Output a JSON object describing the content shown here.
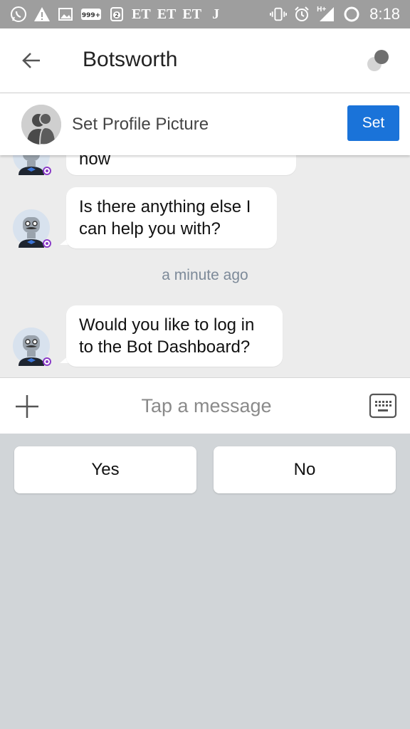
{
  "status_bar": {
    "time": "8:18",
    "notif_badge": "999+",
    "notif_badge2": "2",
    "carrier_marks": [
      "ET",
      "ET",
      "ET"
    ],
    "j_mark": "J",
    "network_label": "H+",
    "icons": [
      "whatsapp-icon",
      "warning-icon",
      "image-icon",
      "notification-count-icon",
      "sim-icon",
      "app-icon",
      "vibrate-icon",
      "alarm-icon",
      "signal-icon",
      "battery-icon"
    ]
  },
  "app_bar": {
    "title": "Botsworth",
    "back_icon": "arrow-left-icon",
    "menu_icon": "theme-toggle-icon"
  },
  "profile_banner": {
    "label": "Set Profile Picture",
    "button_label": "Set",
    "button_color": "#1a73d9"
  },
  "messages": [
    {
      "sender": "bot",
      "lines": [
        "now"
      ]
    },
    {
      "sender": "bot",
      "lines": [
        "Is there anything else I",
        "can help you with?"
      ]
    },
    {
      "sender": "bot",
      "lines": [
        "Would you like to log in",
        "to the Bot Dashboard?"
      ]
    }
  ],
  "timestamp": "a minute ago",
  "composer": {
    "placeholder": "Tap a message",
    "plus_icon": "plus-icon",
    "keyboard_icon": "keyboard-icon"
  },
  "quick_replies": [
    "Yes",
    "No"
  ],
  "colors": {
    "status_bar": "#9e9e9e",
    "chat_background": "#ececec",
    "bottom_background": "#d1d5d8",
    "timestamp_text": "#7d8a99",
    "presence_ring": "#8a3cc8"
  }
}
